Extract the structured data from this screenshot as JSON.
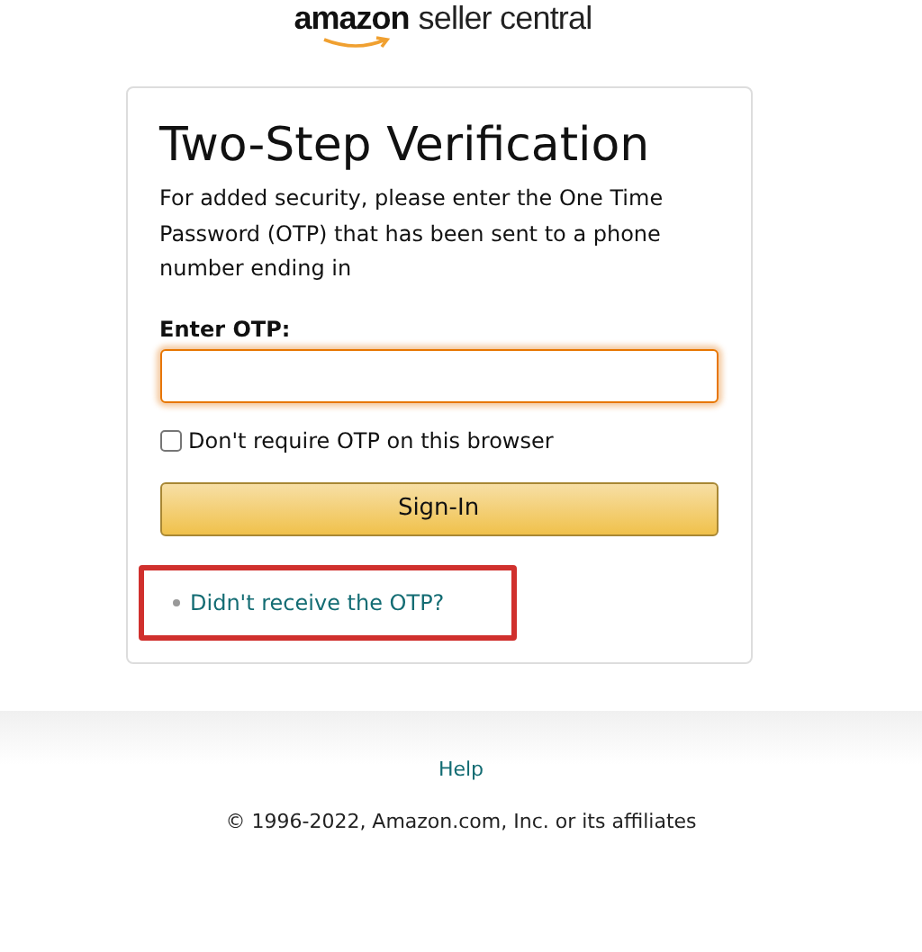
{
  "logo": {
    "brand": "amazon",
    "product": "seller central"
  },
  "card": {
    "title": "Two-Step Verification",
    "message": "For added security, please enter the One Time Password (OTP) that has been sent to a phone number ending in",
    "otp_field": {
      "label": "Enter OTP:"
    },
    "remember": {
      "label": "Don't require OTP on this browser",
      "checked": false
    },
    "submit": "Sign-In",
    "help_link": {
      "label": "Didn't receive the OTP?",
      "highlighted": true
    }
  },
  "footer": {
    "link": "Help",
    "copyright": "© 1996-2022, Amazon.com, Inc. or its affiliates"
  }
}
